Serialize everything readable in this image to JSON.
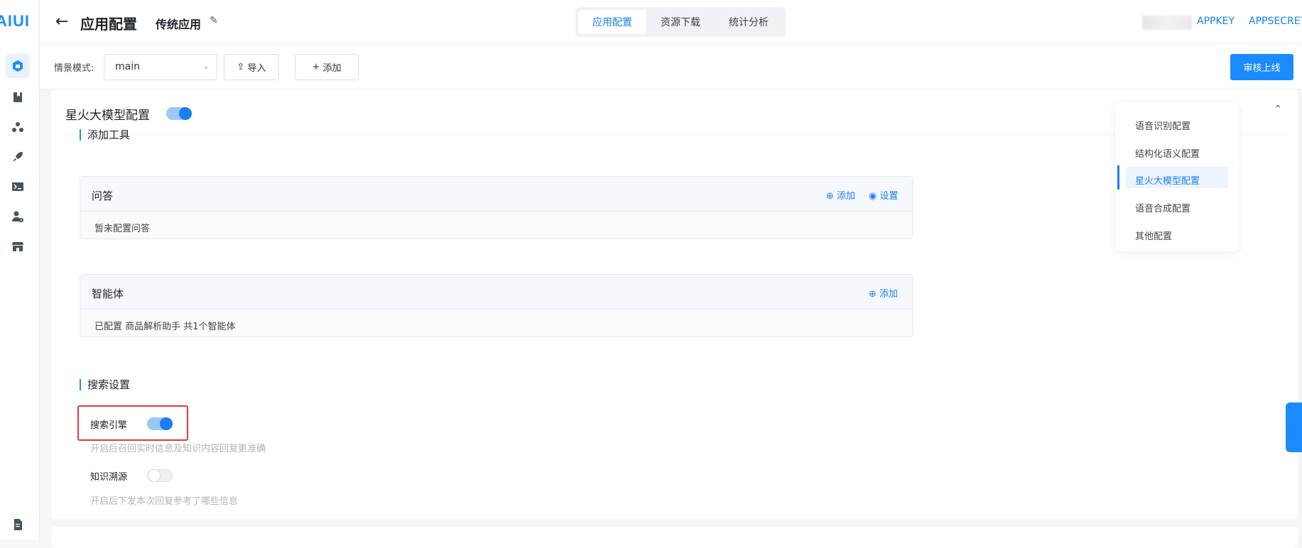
{
  "sidebar": {
    "logo": "AIUI",
    "icons": [
      "app-icon",
      "book-icon",
      "tree-icon",
      "rocket-icon",
      "terminal-icon",
      "user-settings-icon",
      "store-icon",
      "document-icon"
    ]
  },
  "header": {
    "back_icon": "←",
    "title": "应用配置",
    "app_name": "传统应用",
    "edit_icon": "✎",
    "tabs": [
      {
        "label": "应用配置",
        "active": true
      },
      {
        "label": "资源下载",
        "active": false
      },
      {
        "label": "统计分析",
        "active": false
      }
    ],
    "appkey_label": "APPKEY",
    "appsecret_label": "APPSECRET"
  },
  "toolbar": {
    "scene_label": "情景模式:",
    "scene_value": "main",
    "import_label": "导入",
    "add_label": "添加",
    "publish_label": "审核上线"
  },
  "config": {
    "title": "星火大模型配置",
    "enabled": true,
    "tools_section": "添加工具",
    "qa": {
      "title": "问答",
      "add": "添加",
      "settings": "设置",
      "body": "暂未配置问答"
    },
    "agent": {
      "title": "智能体",
      "add": "添加",
      "body": "已配置 商品解析助手 共1个智能体"
    },
    "search_section": "搜索设置",
    "search_engine": {
      "label": "搜索引擎",
      "enabled": true,
      "desc": "开启后召回实时信息及知识内容回复更准确"
    },
    "knowledge_trace": {
      "label": "知识溯源",
      "enabled": false,
      "desc": "开启后下发本次回复参考了哪些信息"
    }
  },
  "anchor": {
    "items": [
      {
        "label": "语音识别配置",
        "active": false
      },
      {
        "label": "结构化语义配置",
        "active": false
      },
      {
        "label": "星火大模型配置",
        "active": true
      },
      {
        "label": "语音合成配置",
        "active": false
      },
      {
        "label": "其他配置",
        "active": false
      }
    ]
  },
  "colors": {
    "accent": "#1a8cff",
    "link": "#1a7ff0",
    "highlight": "#e03a3a"
  }
}
